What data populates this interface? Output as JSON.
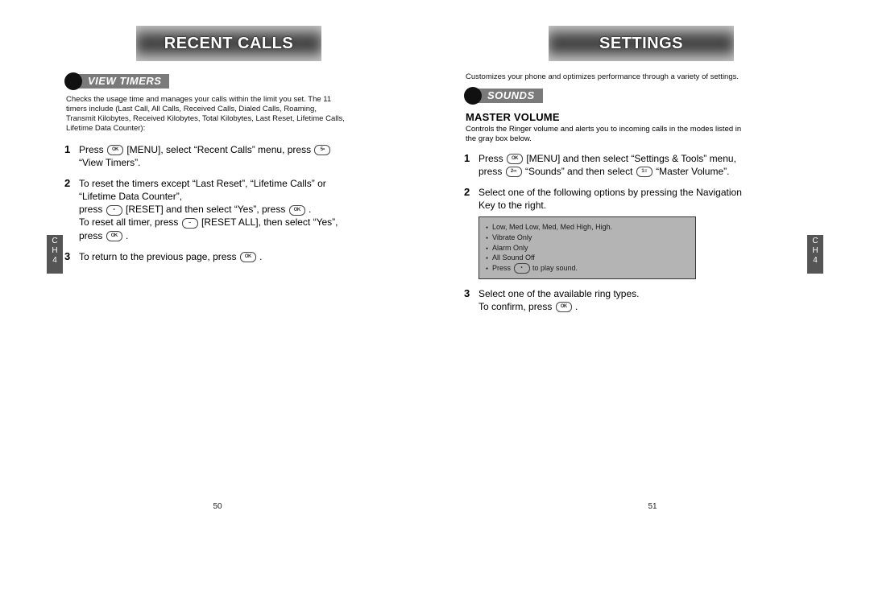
{
  "left": {
    "header": "RECENT CALLS",
    "section": "VIEW TIMERS",
    "intro": "Checks the usage time and manages your calls within the limit you set. The 11 timers include (Last Call, All Calls, Received Calls, Dialed Calls, Roaming, Transmit Kilobytes, Received Kilobytes, Total Kilobytes, Last Reset, Lifetime Calls, Lifetime Data Counter):",
    "steps": [
      {
        "n": "1",
        "lines": [
          "Press ",
          " [MENU], select “Recent Calls” menu, press ",
          " “View Timers”."
        ],
        "keys": [
          "ok",
          "5"
        ]
      },
      {
        "n": "2",
        "lines": [
          "To reset the timers except “Last Reset”, “Lifetime Calls” or “Lifetime Data Counter”,",
          "press ",
          " [RESET] and then select “Yes”, press ",
          " .",
          "To reset all timer, press ",
          " [RESET ALL], then select “Yes”, press ",
          " ."
        ],
        "keys": [
          "reset",
          "ok",
          "soft",
          "ok"
        ]
      },
      {
        "n": "3",
        "lines": [
          "To return to the previous page, press ",
          " ."
        ],
        "keys": [
          "ok"
        ]
      }
    ],
    "sideTab": {
      "label": "C\nH",
      "num": "4"
    },
    "pageNum": "50"
  },
  "right": {
    "header": "SETTINGS",
    "intro": "Customizes your phone and optimizes performance through a variety of settings.",
    "section": "SOUNDS",
    "subhead": "MASTER VOLUME",
    "subIntro": "Controls the Ringer volume and alerts you to incoming calls in the modes listed in the gray box below.",
    "steps": [
      {
        "n": "1",
        "lines": [
          "Press ",
          " [MENU] and then select “Settings & Tools” menu, press ",
          " “Sounds” and then select ",
          " “Master Volume”."
        ],
        "keys": [
          "ok",
          "2",
          "1"
        ]
      },
      {
        "n": "2",
        "lines": [
          "Select one of the following options by pressing the Navigation Key to the right."
        ],
        "keys": []
      },
      {
        "n": "3",
        "lines": [
          "Select one of the available ring types.",
          "To confirm, press ",
          " ."
        ],
        "keys": [
          "ok"
        ]
      }
    ],
    "options": [
      "Low, Med Low, Med, Med High, High.",
      "Vibrate Only",
      "Alarm Only",
      "All Sound Off",
      "Press   to play sound."
    ],
    "sideTab": {
      "label": "C\nH",
      "num": "4"
    },
    "pageNum": "51"
  }
}
